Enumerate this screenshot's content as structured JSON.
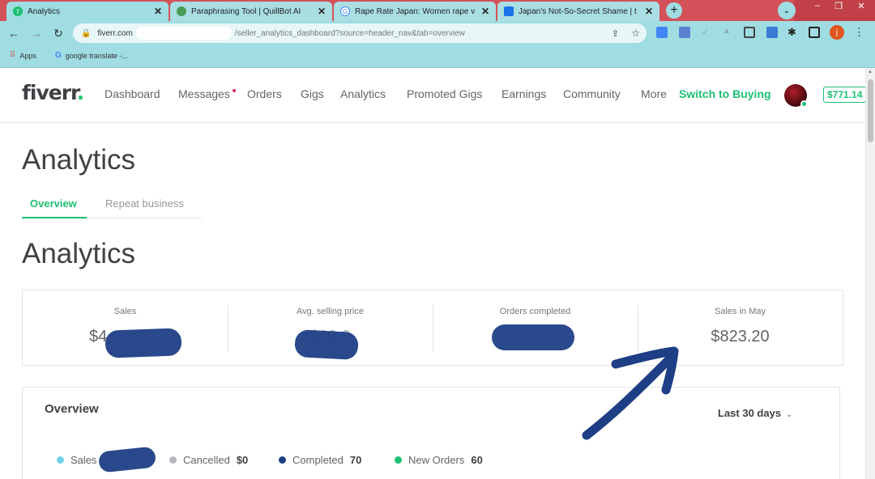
{
  "browser": {
    "tabs": [
      {
        "title": "Analytics",
        "icon": "fiverr-favicon",
        "color": "#1dbf73"
      },
      {
        "title": "Paraphrasing Tool | QuillBot AI",
        "icon": "quillbot-favicon",
        "color": "#4a9b5a"
      },
      {
        "title": "Rape Rate Japan: Women rape v",
        "icon": "google-favicon",
        "color": "#4285f4"
      },
      {
        "title": "Japan's Not-So-Secret Shame | t",
        "icon": "site-favicon",
        "color": "#1a73e8"
      }
    ],
    "url_host": "fiverr.com",
    "url_path": "/seller_analytics_dashboard?source=header_nav&tab=overview",
    "bookmarks": [
      {
        "label": "Apps",
        "icon": "apps-grid-icon"
      },
      {
        "label": "google translate -...",
        "icon": "google-icon"
      }
    ],
    "profile_initial": "j"
  },
  "header": {
    "logo_text": "fiverr",
    "logo_dot": ".",
    "nav": [
      "Dashboard",
      "Messages",
      "Orders",
      "Gigs",
      "Analytics",
      "Promoted Gigs",
      "Earnings",
      "Community",
      "More"
    ],
    "switch_label": "Switch to Buying",
    "balance": "$771.14"
  },
  "page": {
    "title": "Analytics",
    "subtabs": [
      "Overview",
      "Repeat business"
    ],
    "section_title": "Analytics"
  },
  "stats": [
    {
      "label": "Sales",
      "value": "$4"
    },
    {
      "label": "Avg. selling price",
      "value": "$10.0"
    },
    {
      "label": "Orders completed",
      "value": ""
    },
    {
      "label": "Sales in May",
      "value": "$823.20"
    }
  ],
  "overview": {
    "title": "Overview",
    "range": "Last 30 days",
    "legend": [
      {
        "label": "Sales",
        "value": "",
        "color": "#6fd3e6"
      },
      {
        "label": "Cancelled",
        "value": "$0",
        "color": "#b5b6ba"
      },
      {
        "label": "Completed",
        "value": "70",
        "color": "#1e3f86"
      },
      {
        "label": "New Orders",
        "value": "60",
        "color": "#1dbf73"
      }
    ]
  }
}
